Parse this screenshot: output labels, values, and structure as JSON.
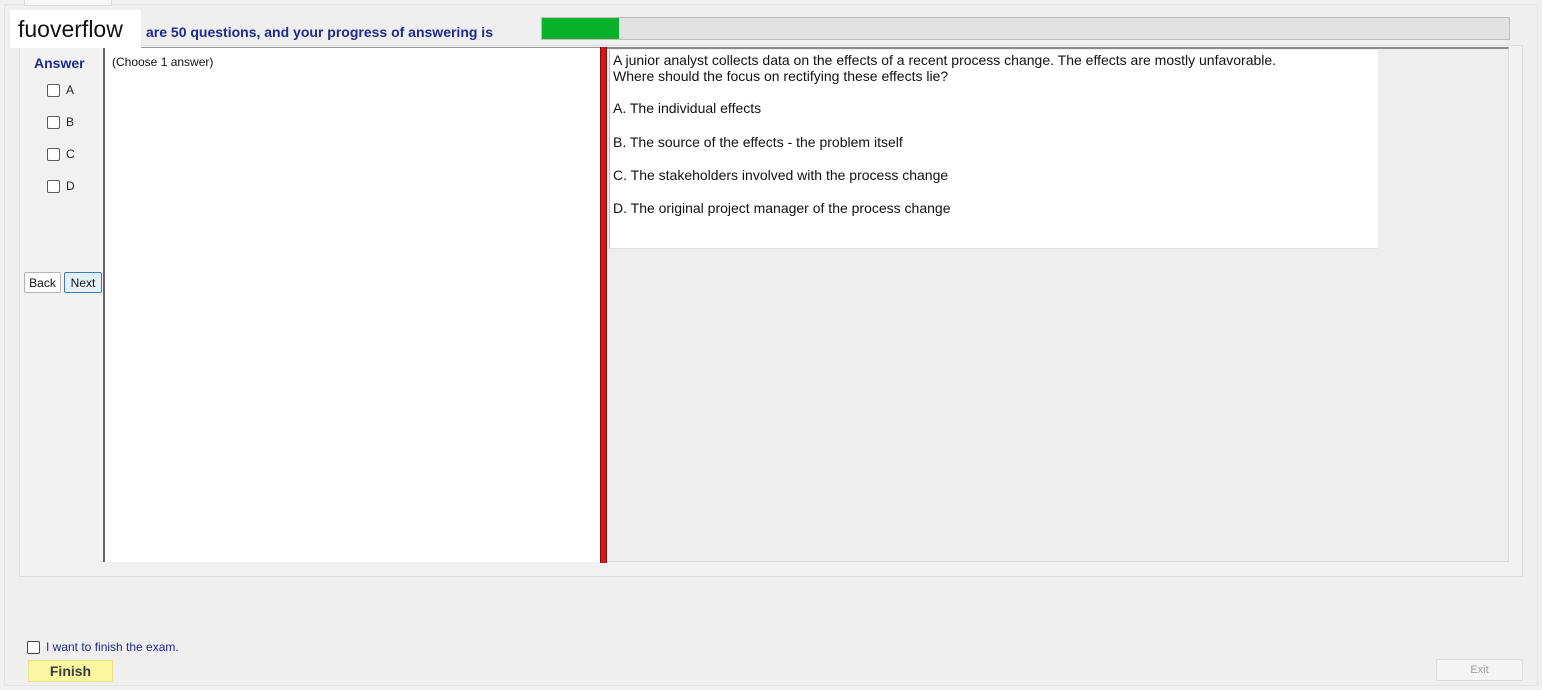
{
  "watermark": "fuoverflow",
  "header": {
    "progress_text": "are 50 questions, and your progress of answering is",
    "progress_fraction": 0.08
  },
  "answer_panel": {
    "label": "Answer",
    "choices": [
      "A",
      "B",
      "C",
      "D"
    ],
    "back_label": "Back",
    "next_label": "Next"
  },
  "instructions": "(Choose 1 answer)",
  "question": {
    "stem_line1": "A junior analyst collects data on the effects of a recent process change. The effects are mostly unfavorable.",
    "stem_line2": "Where should the focus on rectifying these effects lie?",
    "options": [
      "A.  The individual effects",
      "B.  The source of the effects - the problem itself",
      "C.  The stakeholders involved with the process change",
      "D.  The original project manager of the process change"
    ]
  },
  "footer": {
    "finish_checkbox_label": "I want to finish the exam.",
    "finish_label": "Finish",
    "exit_label": "Exit"
  },
  "colors": {
    "accent_text": "#1f2a8c",
    "progress": "#09b02a",
    "splitter": "#d9151b",
    "finish_bg": "#fbf6a2"
  }
}
